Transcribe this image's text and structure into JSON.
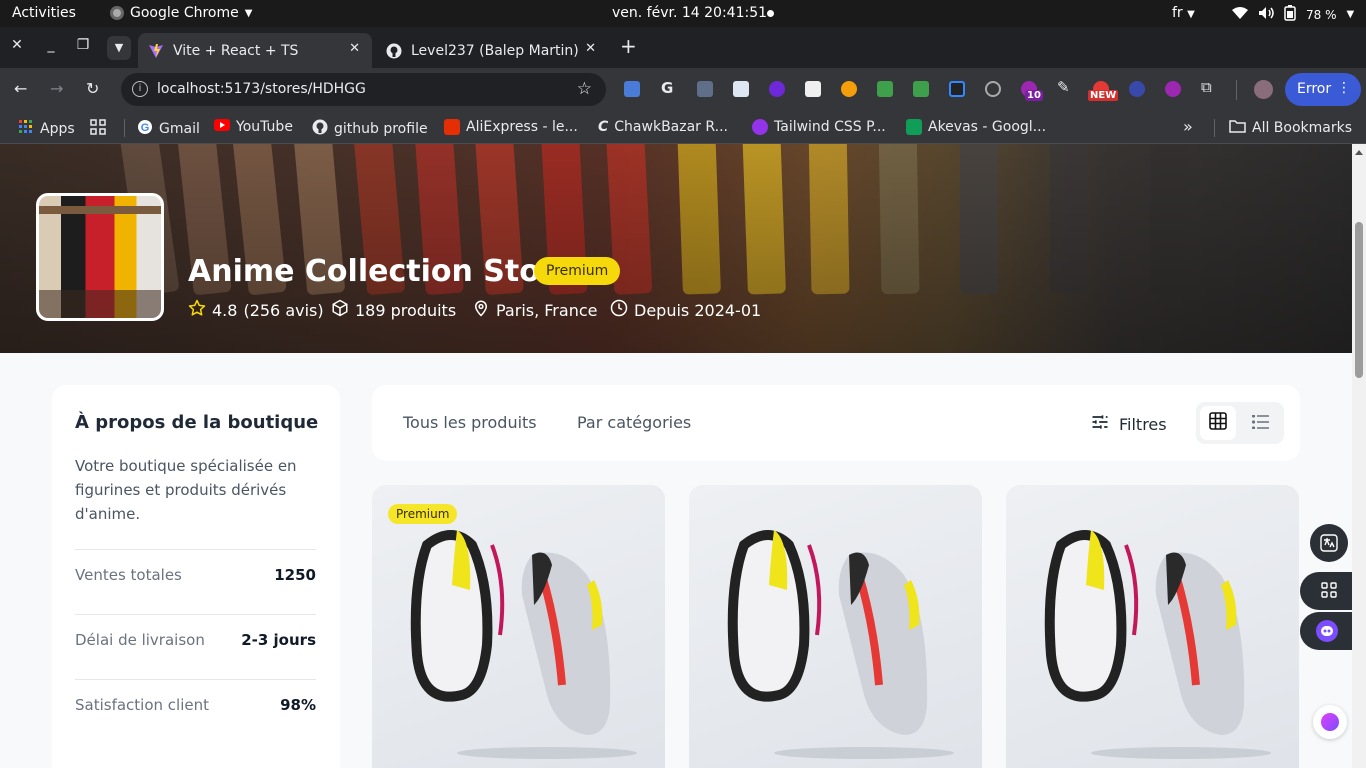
{
  "os": {
    "activities": "Activities",
    "app_name": "Google Chrome",
    "clock": "ven. févr. 14  20:41:51",
    "language": "fr",
    "battery": "78 %"
  },
  "browser": {
    "tabs": [
      {
        "title": "Vite + React + TS",
        "active": true
      },
      {
        "title": "Level237 (Balep Martin)",
        "active": false
      }
    ],
    "url": "localhost:5173/stores/HDHGG",
    "error_button": "Error",
    "ext_badge_count": "10",
    "ext_badge_new": "NEW",
    "bookmarks": [
      {
        "label": "Apps"
      },
      {
        "label": "Gmail"
      },
      {
        "label": "YouTube"
      },
      {
        "label": "github profile"
      },
      {
        "label": "AliExpress - le..."
      },
      {
        "label": "ChawkBazar R..."
      },
      {
        "label": "Tailwind CSS P..."
      },
      {
        "label": "Akevas - Googl..."
      }
    ],
    "all_bookmarks": "All Bookmarks",
    "more_bookmarks": "»"
  },
  "store": {
    "name": "Anime Collection Store",
    "badge": "Premium",
    "rating": "4.8",
    "reviews": "(256 avis)",
    "products": "189 produits",
    "location": "Paris, France",
    "since": "Depuis 2024-01"
  },
  "about": {
    "title": "À propos de la boutique",
    "description": "Votre boutique spécialisée en figurines et produits dérivés d'anime.",
    "stats": [
      {
        "label": "Ventes totales",
        "value": "1250"
      },
      {
        "label": "Délai de livraison",
        "value": "2-3 jours"
      },
      {
        "label": "Satisfaction client",
        "value": "98%"
      }
    ]
  },
  "product_tabs": {
    "all": "Tous les produits",
    "by_category": "Par catégories",
    "filters": "Filtres",
    "view_mode": "grid"
  },
  "products": [
    {
      "tag": "Premium",
      "image": "sneakers"
    },
    {
      "tag": "",
      "image": "sneakers"
    },
    {
      "tag": "",
      "image": "sneakers"
    }
  ],
  "colors": {
    "premium": "#f5d90a",
    "chrome_dark": "#202124",
    "error_button": "#3b5ad6"
  }
}
